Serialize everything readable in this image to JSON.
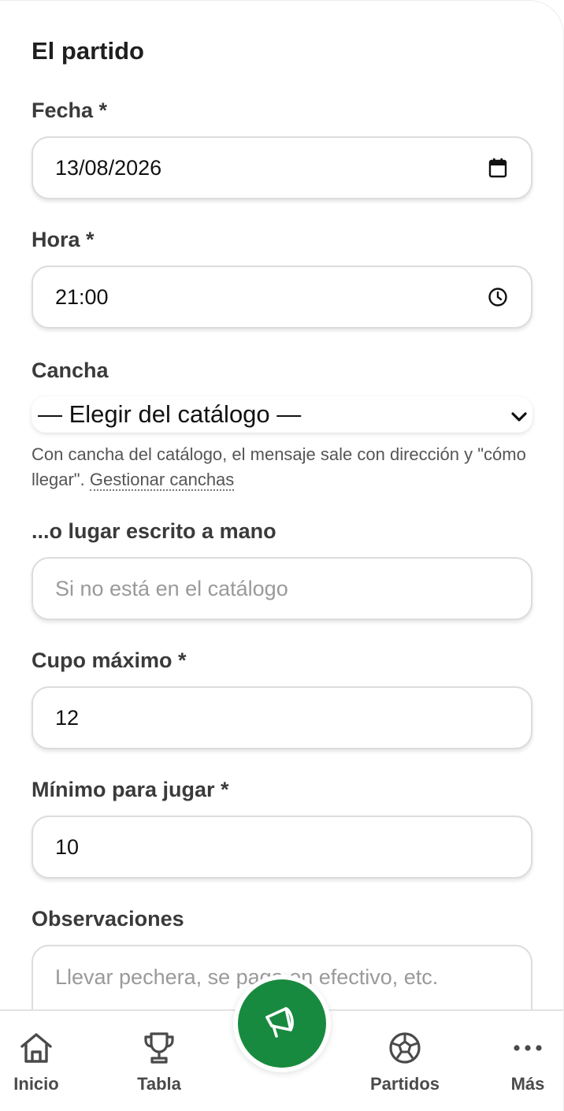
{
  "form": {
    "section_title": "El partido",
    "fecha": {
      "label": "Fecha *",
      "value": "13/08/2026",
      "icon": "calendar-icon"
    },
    "hora": {
      "label": "Hora *",
      "value": "21:00",
      "icon": "clock-icon"
    },
    "cancha": {
      "label": "Cancha",
      "selected": "— Elegir del catálogo —",
      "icon": "chevron-down-icon",
      "help_text": "Con cancha del catálogo, el mensaje sale con dirección y \"cómo llegar\".",
      "help_link": "Gestionar canchas"
    },
    "lugar": {
      "label": "...o lugar escrito a mano",
      "placeholder": "Si no está en el catálogo"
    },
    "cupo": {
      "label": "Cupo máximo *",
      "value": "12"
    },
    "minimo": {
      "label": "Mínimo para jugar *",
      "value": "10"
    },
    "observaciones": {
      "label": "Observaciones",
      "placeholder": "Llevar pechera, se paga en efectivo, etc."
    }
  },
  "nav": {
    "items": [
      {
        "label": "Inicio",
        "icon": "home-icon"
      },
      {
        "label": "Tabla",
        "icon": "trophy-icon"
      },
      {
        "label": "Partidos",
        "icon": "soccer-ball-icon"
      },
      {
        "label": "Más",
        "icon": "more-icon"
      }
    ],
    "fab_icon": "megaphone-icon",
    "accent": "#188a3f"
  }
}
